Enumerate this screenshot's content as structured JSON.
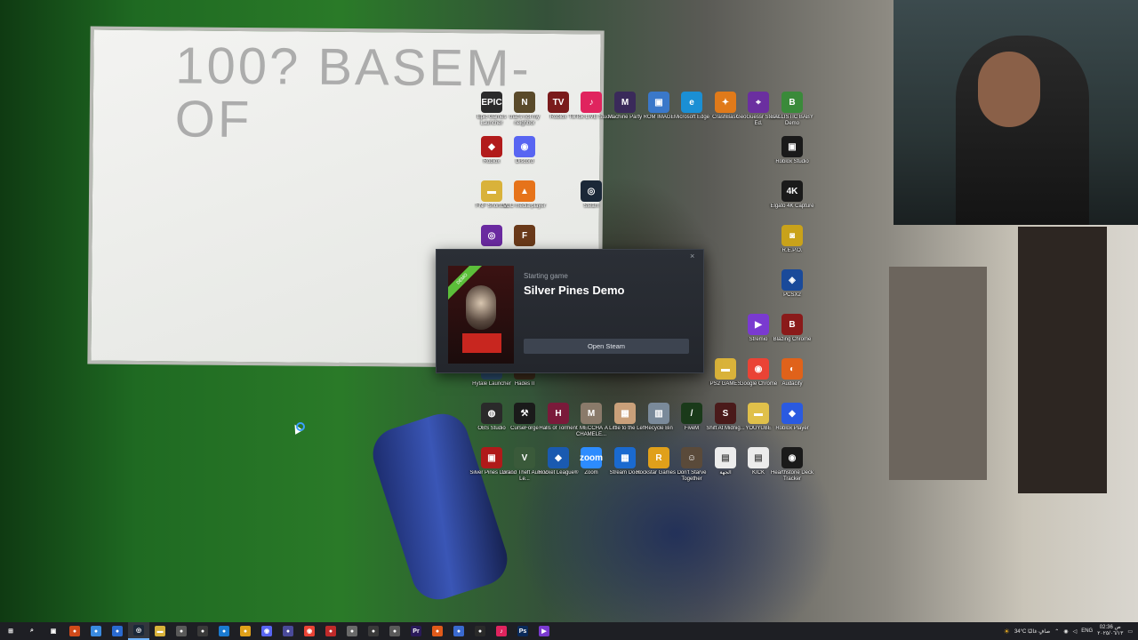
{
  "wallpaper": {
    "whiteboard_text": "100? BASEM-OF"
  },
  "desktop_icons": [
    {
      "label": "Epic Games Launcher",
      "glyph": "EPIC",
      "color": "#2b2b2b",
      "icon": "epic-games-icon"
    },
    {
      "label": "that's not my neighbor",
      "glyph": "N",
      "color": "#5a4a2a",
      "icon": "game-icon"
    },
    {
      "label": "Roblox",
      "glyph": "TV",
      "color": "#7a1b1b",
      "icon": "game-icon"
    },
    {
      "label": "TikTok LIVE Studio",
      "glyph": "♪",
      "color": "#e0245e",
      "icon": "tiktok-icon"
    },
    {
      "label": "Machine Party",
      "glyph": "M",
      "color": "#3a2a5a",
      "icon": "game-icon"
    },
    {
      "label": "ROM IMAGE",
      "glyph": "▣",
      "color": "#3a78c9",
      "icon": "disc-image-icon"
    },
    {
      "label": "Microsoft Edge",
      "glyph": "e",
      "color": "#1b8fd4",
      "icon": "edge-icon"
    },
    {
      "label": "CrashBash",
      "glyph": "✦",
      "color": "#e07a1a",
      "icon": "game-icon"
    },
    {
      "label": "GeoGuessr Steam Ed.",
      "glyph": "⌖",
      "color": "#6b2fa0",
      "icon": "game-icon"
    },
    {
      "label": "BALLISTIC BABY Demo",
      "glyph": "B",
      "color": "#3a8a3a",
      "icon": "game-icon"
    },
    {
      "label": "Roblox",
      "glyph": "◆",
      "color": "#b21b1b",
      "icon": "game-icon"
    },
    {
      "label": "Discord",
      "glyph": "◉",
      "color": "#5865f2",
      "icon": "discord-icon"
    },
    {
      "label": "Roblox Studio",
      "glyph": "▣",
      "color": "#1a1a1a",
      "icon": "roblox-studio-icon"
    },
    {
      "label": "FNF Shortcut",
      "glyph": "▬",
      "color": "#d9b23a",
      "icon": "folder-icon"
    },
    {
      "label": "VLC media player",
      "glyph": "▲",
      "color": "#e6731a",
      "icon": "vlc-icon"
    },
    {
      "label": "Steam",
      "glyph": "◎",
      "color": "#1b2838",
      "icon": "steam-icon"
    },
    {
      "label": "Elgato 4K Capture",
      "glyph": "4K",
      "color": "#1a1a1a",
      "icon": "capture-icon"
    },
    {
      "label": "",
      "glyph": "◎",
      "color": "#6a2aa0",
      "icon": "app-icon"
    },
    {
      "label": "",
      "glyph": "F",
      "color": "#6a3a1a",
      "icon": "game-icon"
    },
    {
      "label": "R.E.P.O.",
      "glyph": "◙",
      "color": "#c9a21a",
      "icon": "game-icon"
    },
    {
      "label": "PCSX2",
      "glyph": "◈",
      "color": "#1a4a9a",
      "icon": "pcsx2-icon"
    },
    {
      "label": "Stremio",
      "glyph": "▶",
      "color": "#7a3ad0",
      "icon": "stremio-icon"
    },
    {
      "label": "Blazing Chrome",
      "glyph": "B",
      "color": "#8a1a1a",
      "icon": "game-icon"
    },
    {
      "label": "Hytale Launcher",
      "glyph": "H",
      "color": "#2a4a6a",
      "icon": "game-icon"
    },
    {
      "label": "Hades II",
      "glyph": "H",
      "color": "#3a2a1a",
      "icon": "game-icon"
    },
    {
      "label": "PS2 GAMES",
      "glyph": "▬",
      "color": "#d9b23a",
      "icon": "folder-icon"
    },
    {
      "label": "Google Chrome",
      "glyph": "◉",
      "color": "#ea4335",
      "icon": "chrome-icon"
    },
    {
      "label": "Audacity",
      "glyph": "◐",
      "color": "#e0621a",
      "icon": "audacity-icon"
    },
    {
      "label": "OBS Studio",
      "glyph": "◍",
      "color": "#2a2a2a",
      "icon": "obs-icon"
    },
    {
      "label": "CurseForge",
      "glyph": "⚒",
      "color": "#1a1a1a",
      "icon": "curseforge-icon"
    },
    {
      "label": "Halls of Torment",
      "glyph": "H",
      "color": "#7a1a3a",
      "icon": "game-icon"
    },
    {
      "label": "MECCHA CHAMELE...",
      "glyph": "M",
      "color": "#8a7a6a",
      "icon": "game-icon"
    },
    {
      "label": "A Little to the Left",
      "glyph": "▦",
      "color": "#c9a07a",
      "icon": "game-icon"
    },
    {
      "label": "Recycle Bin",
      "glyph": "▥",
      "color": "#7a8a9a",
      "icon": "recycle-bin-icon"
    },
    {
      "label": "FiveM",
      "glyph": "/",
      "color": "#1a3a1a",
      "icon": "fivem-icon"
    },
    {
      "label": "Shift At Midnig...",
      "glyph": "S",
      "color": "#4a1a1a",
      "icon": "game-icon"
    },
    {
      "label": "YOUYUBE",
      "glyph": "▬",
      "color": "#e0c04a",
      "icon": "shortcut-icon"
    },
    {
      "label": "Roblox Player",
      "glyph": "◆",
      "color": "#2a5ae0",
      "icon": "roblox-icon"
    },
    {
      "label": "Silver Pines Demo",
      "glyph": "▣",
      "color": "#b01a1a",
      "icon": "game-icon"
    },
    {
      "label": "Grand Theft Auto V Le...",
      "glyph": "V",
      "color": "#3a5a3a",
      "icon": "gta-icon"
    },
    {
      "label": "Rocket League®",
      "glyph": "◆",
      "color": "#1a5ab0",
      "icon": "rocket-league-icon"
    },
    {
      "label": "Zoom",
      "glyph": "zoom",
      "color": "#2d8cff",
      "icon": "zoom-icon"
    },
    {
      "label": "Stream Dock",
      "glyph": "▦",
      "color": "#1a6ad0",
      "icon": "stream-dock-icon"
    },
    {
      "label": "Rockstar Games ...",
      "glyph": "R",
      "color": "#e0a01a",
      "icon": "rockstar-icon"
    },
    {
      "label": "Don't Starve Together",
      "glyph": "☺",
      "color": "#5a4a3a",
      "icon": "game-icon"
    },
    {
      "label": "الجهة",
      "glyph": "▤",
      "color": "#ececec",
      "icon": "document-icon"
    },
    {
      "label": "KICK",
      "glyph": "▤",
      "color": "#ececec",
      "icon": "document-icon"
    },
    {
      "label": "Hearthstone Deck Tracker",
      "glyph": "◉",
      "color": "#1a1a1a",
      "icon": "hearthstone-icon"
    }
  ],
  "steam_popup": {
    "subtitle": "Starting game",
    "title": "Silver Pines Demo",
    "button": "Open Steam",
    "close": "×",
    "cover_ribbon": "DEMO"
  },
  "taskbar": {
    "apps": [
      {
        "name": "start-button",
        "glyph": "⊞",
        "color": "#1e1f24"
      },
      {
        "name": "search-icon",
        "glyph": "⌕",
        "color": "#1e1f24"
      },
      {
        "name": "task-view-icon",
        "glyph": "▣",
        "color": "#1e1f24"
      },
      {
        "name": "app-icon",
        "glyph": "●",
        "color": "#d04a1a"
      },
      {
        "name": "app-icon",
        "glyph": "●",
        "color": "#3a8ae0"
      },
      {
        "name": "app-icon",
        "glyph": "●",
        "color": "#2a6ad0"
      },
      {
        "name": "steam-icon",
        "glyph": "◎",
        "color": "#1b2838"
      },
      {
        "name": "folder-icon",
        "glyph": "▬",
        "color": "#d9b23a"
      },
      {
        "name": "app-icon",
        "glyph": "●",
        "color": "#5a5a5a"
      },
      {
        "name": "app-icon",
        "glyph": "●",
        "color": "#3a3a3a"
      },
      {
        "name": "app-icon",
        "glyph": "●",
        "color": "#1a7ad0"
      },
      {
        "name": "app-icon",
        "glyph": "●",
        "color": "#e0a01a"
      },
      {
        "name": "discord-icon",
        "glyph": "◉",
        "color": "#5865f2"
      },
      {
        "name": "app-icon",
        "glyph": "●",
        "color": "#4a4a9a"
      },
      {
        "name": "chrome-icon",
        "glyph": "◉",
        "color": "#ea4335"
      },
      {
        "name": "app-icon",
        "glyph": "●",
        "color": "#c02a2a"
      },
      {
        "name": "app-icon",
        "glyph": "●",
        "color": "#6a6a6a"
      },
      {
        "name": "app-icon",
        "glyph": "●",
        "color": "#3a3a3a"
      },
      {
        "name": "app-icon",
        "glyph": "●",
        "color": "#5a5a5a"
      },
      {
        "name": "premiere-icon",
        "glyph": "Pr",
        "color": "#2a1a5a"
      },
      {
        "name": "app-icon",
        "glyph": "●",
        "color": "#e05a1a"
      },
      {
        "name": "app-icon",
        "glyph": "●",
        "color": "#3a6ad0"
      },
      {
        "name": "app-icon",
        "glyph": "●",
        "color": "#2a2a2a"
      },
      {
        "name": "tiktok-icon",
        "glyph": "♪",
        "color": "#e0245e"
      },
      {
        "name": "photoshop-icon",
        "glyph": "Ps",
        "color": "#0a2a5a"
      },
      {
        "name": "stremio-icon",
        "glyph": "▶",
        "color": "#7a3ad0"
      }
    ],
    "active_index": 6,
    "weather": "34°C صافٍ غالبًا",
    "language": "ENG",
    "time": "02:36 ص",
    "date": "٢٠٢٥/٠٦/١٣"
  }
}
